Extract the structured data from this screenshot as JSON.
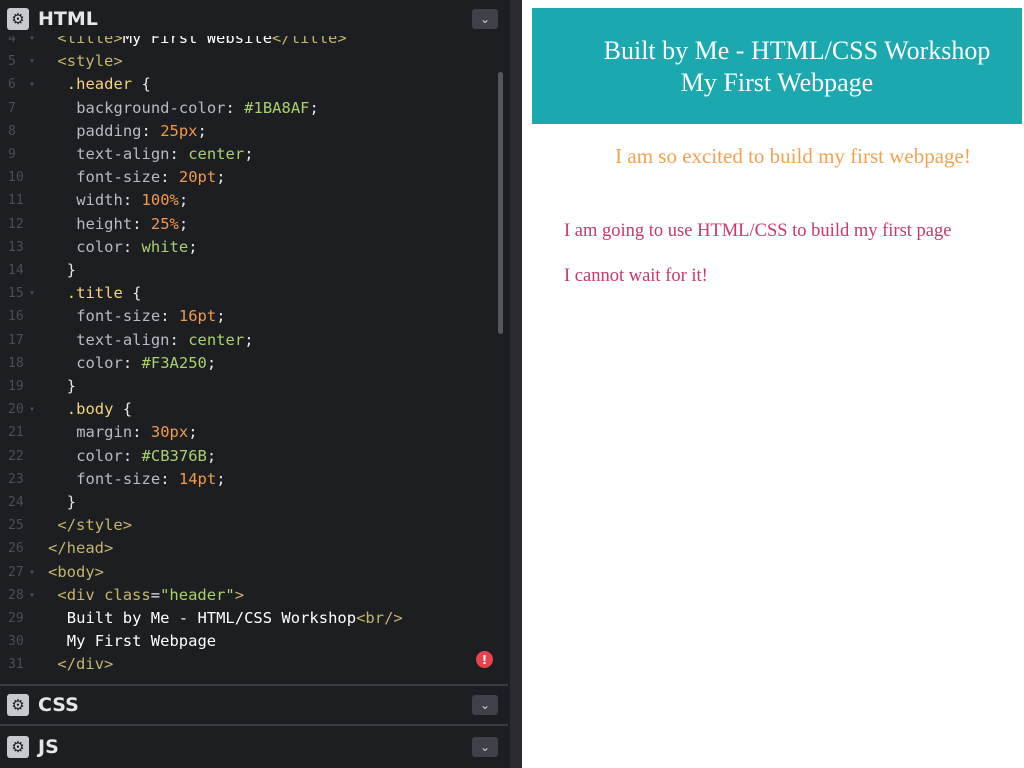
{
  "editor": {
    "panels": {
      "html": "HTML",
      "css": "CSS",
      "js": "JS"
    },
    "lines": [
      {
        "n": "4",
        "fold": true,
        "parts": [
          [
            "tag",
            "<title>"
          ],
          [
            "white",
            "My First Website"
          ],
          [
            "tag",
            "</title>"
          ]
        ],
        "indent": 1
      },
      {
        "n": "5",
        "fold": true,
        "parts": [
          [
            "tag",
            "<style>"
          ]
        ],
        "indent": 1
      },
      {
        "n": "6",
        "fold": true,
        "parts": [
          [
            "sel",
            ".header"
          ],
          [
            "punct",
            " {"
          ]
        ],
        "indent": 2
      },
      {
        "n": "7",
        "fold": false,
        "parts": [
          [
            "prop",
            "background-color"
          ],
          [
            "punct",
            ": "
          ],
          [
            "hex",
            "#1BA8AF"
          ],
          [
            "punct",
            ";"
          ]
        ],
        "indent": 3
      },
      {
        "n": "8",
        "fold": false,
        "parts": [
          [
            "prop",
            "padding"
          ],
          [
            "punct",
            ": "
          ],
          [
            "num",
            "25px"
          ],
          [
            "punct",
            ";"
          ]
        ],
        "indent": 3
      },
      {
        "n": "9",
        "fold": false,
        "parts": [
          [
            "prop",
            "text-align"
          ],
          [
            "punct",
            ": "
          ],
          [
            "val",
            "center"
          ],
          [
            "punct",
            ";"
          ]
        ],
        "indent": 3
      },
      {
        "n": "10",
        "fold": false,
        "parts": [
          [
            "prop",
            "font-size"
          ],
          [
            "punct",
            ": "
          ],
          [
            "num",
            "20pt"
          ],
          [
            "punct",
            ";"
          ]
        ],
        "indent": 3
      },
      {
        "n": "11",
        "fold": false,
        "parts": [
          [
            "prop",
            "width"
          ],
          [
            "punct",
            ": "
          ],
          [
            "num",
            "100%"
          ],
          [
            "punct",
            ";"
          ]
        ],
        "indent": 3
      },
      {
        "n": "12",
        "fold": false,
        "parts": [
          [
            "prop",
            "height"
          ],
          [
            "punct",
            ": "
          ],
          [
            "num",
            "25%"
          ],
          [
            "punct",
            ";"
          ]
        ],
        "indent": 3
      },
      {
        "n": "13",
        "fold": false,
        "parts": [
          [
            "prop",
            "color"
          ],
          [
            "punct",
            ": "
          ],
          [
            "val",
            "white"
          ],
          [
            "punct",
            ";"
          ]
        ],
        "indent": 3
      },
      {
        "n": "14",
        "fold": false,
        "parts": [
          [
            "punct",
            "}"
          ]
        ],
        "indent": 2
      },
      {
        "n": "15",
        "fold": true,
        "parts": [
          [
            "sel",
            ".title"
          ],
          [
            "punct",
            " {"
          ]
        ],
        "indent": 2
      },
      {
        "n": "16",
        "fold": false,
        "parts": [
          [
            "prop",
            "font-size"
          ],
          [
            "punct",
            ": "
          ],
          [
            "num",
            "16pt"
          ],
          [
            "punct",
            ";"
          ]
        ],
        "indent": 3
      },
      {
        "n": "17",
        "fold": false,
        "parts": [
          [
            "prop",
            "text-align"
          ],
          [
            "punct",
            ": "
          ],
          [
            "val",
            "center"
          ],
          [
            "punct",
            ";"
          ]
        ],
        "indent": 3
      },
      {
        "n": "18",
        "fold": false,
        "parts": [
          [
            "prop",
            "color"
          ],
          [
            "punct",
            ": "
          ],
          [
            "hex",
            "#F3A250"
          ],
          [
            "punct",
            ";"
          ]
        ],
        "indent": 3
      },
      {
        "n": "19",
        "fold": false,
        "parts": [
          [
            "punct",
            "}"
          ]
        ],
        "indent": 2
      },
      {
        "n": "20",
        "fold": true,
        "parts": [
          [
            "sel",
            ".body"
          ],
          [
            "punct",
            " {"
          ]
        ],
        "indent": 2
      },
      {
        "n": "21",
        "fold": false,
        "parts": [
          [
            "prop",
            "margin"
          ],
          [
            "punct",
            ": "
          ],
          [
            "num",
            "30px"
          ],
          [
            "punct",
            ";"
          ]
        ],
        "indent": 3
      },
      {
        "n": "22",
        "fold": false,
        "parts": [
          [
            "prop",
            "color"
          ],
          [
            "punct",
            ": "
          ],
          [
            "hex",
            "#CB376B"
          ],
          [
            "punct",
            ";"
          ]
        ],
        "indent": 3
      },
      {
        "n": "23",
        "fold": false,
        "parts": [
          [
            "prop",
            "font-size"
          ],
          [
            "punct",
            ": "
          ],
          [
            "num",
            "14pt"
          ],
          [
            "punct",
            ";"
          ]
        ],
        "indent": 3
      },
      {
        "n": "24",
        "fold": false,
        "parts": [
          [
            "punct",
            "}"
          ]
        ],
        "indent": 2
      },
      {
        "n": "25",
        "fold": false,
        "parts": [
          [
            "tag",
            "</style>"
          ]
        ],
        "indent": 1
      },
      {
        "n": "26",
        "fold": false,
        "parts": [
          [
            "tag",
            "</head>"
          ]
        ],
        "indent": 0
      },
      {
        "n": "27",
        "fold": true,
        "parts": [
          [
            "tag",
            "<body>"
          ]
        ],
        "indent": 0
      },
      {
        "n": "28",
        "fold": true,
        "parts": [
          [
            "tag",
            "<div "
          ],
          [
            "attr",
            "class"
          ],
          [
            "punct",
            "="
          ],
          [
            "str",
            "\"header\""
          ],
          [
            "tag",
            ">"
          ]
        ],
        "indent": 1
      },
      {
        "n": "29",
        "fold": false,
        "parts": [
          [
            "white",
            "Built by Me - HTML/CSS Workshop"
          ],
          [
            "tag",
            "<br/>"
          ]
        ],
        "indent": 2
      },
      {
        "n": "30",
        "fold": false,
        "parts": [
          [
            "white",
            "My First Webpage"
          ]
        ],
        "indent": 2
      },
      {
        "n": "31",
        "fold": false,
        "parts": [
          [
            "tag",
            "</div>"
          ]
        ],
        "indent": 1
      }
    ]
  },
  "preview": {
    "header_line1": "Built by Me - HTML/CSS Workshop",
    "header_line2": "My First Webpage",
    "title": "I am so excited to build my first webpage!",
    "body_lines": [
      "I am going to use HTML/CSS to build my first page",
      "I cannot wait for it!"
    ]
  }
}
